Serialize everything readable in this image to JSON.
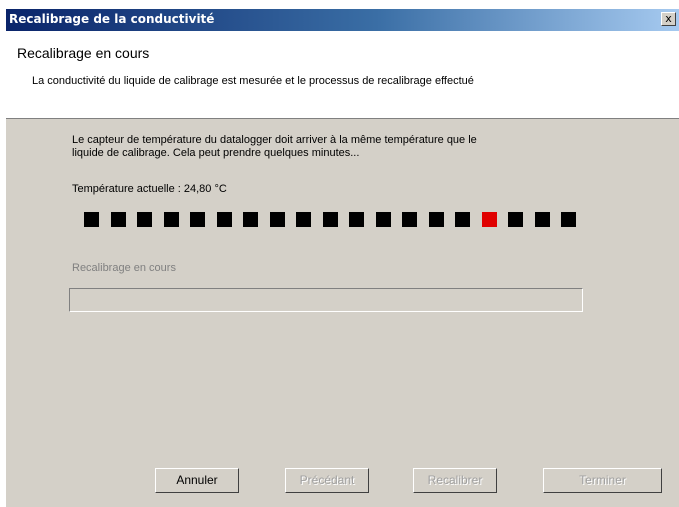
{
  "window": {
    "title": "Recalibrage de la conductivité",
    "close_label": "x"
  },
  "header": {
    "title": "Recalibrage en cours",
    "subtitle": "La conductivité du liquide de calibrage est mesurée et le processus de recalibrage effectué"
  },
  "main": {
    "description_line1": "Le capteur de température du datalogger doit arriver à la même température que le",
    "description_line2": "liquide de calibrage. Cela peut prendre quelques minutes...",
    "temperature_label": "Température actuelle : 24,80 °C",
    "indicator": {
      "count": 19,
      "active_index": 15,
      "color_inactive": "#000000",
      "color_active": "#e00000"
    },
    "progress_label": "Recalibrage en cours",
    "progress_value": 0
  },
  "buttons": {
    "cancel": "Annuler",
    "previous": "Précédant",
    "recalibrate": "Recalibrer",
    "finish": "Terminer"
  }
}
